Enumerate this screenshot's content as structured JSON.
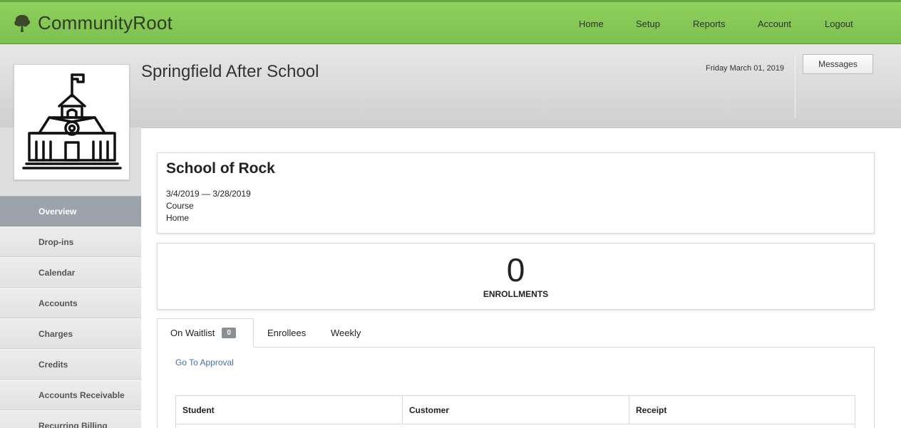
{
  "app": {
    "brand_name": "CommunityRoot",
    "brand_logo_icon": "tree-icon",
    "accent_color": "#7cc04f"
  },
  "nav": {
    "items": [
      {
        "label": "Home"
      },
      {
        "label": "Setup"
      },
      {
        "label": "Reports"
      },
      {
        "label": "Account"
      },
      {
        "label": "Logout"
      }
    ]
  },
  "header": {
    "school_name": "Springfield After School",
    "date": "Friday March 01, 2019",
    "messages_label": "Messages",
    "school_logo_icon": "schoolhouse-icon"
  },
  "sidebar": {
    "items": [
      {
        "label": "Overview",
        "active": true
      },
      {
        "label": "Drop-ins"
      },
      {
        "label": "Calendar"
      },
      {
        "label": "Accounts"
      },
      {
        "label": "Charges"
      },
      {
        "label": "Credits"
      },
      {
        "label": "Accounts Receivable"
      },
      {
        "label": "Recurring Billing"
      }
    ]
  },
  "course": {
    "name": "School of Rock",
    "dates": "3/4/2019 — 3/28/2019",
    "type": "Course",
    "location": "Home"
  },
  "enrollments": {
    "count": "0",
    "label": "ENROLLMENTS"
  },
  "tabs": [
    {
      "label": "On Waitlist",
      "badge": "0",
      "active": true
    },
    {
      "label": "Enrollees"
    },
    {
      "label": "Weekly"
    }
  ],
  "waitlist": {
    "approval_link": "Go To Approval",
    "columns": [
      "Student",
      "Customer",
      "Receipt"
    ]
  }
}
